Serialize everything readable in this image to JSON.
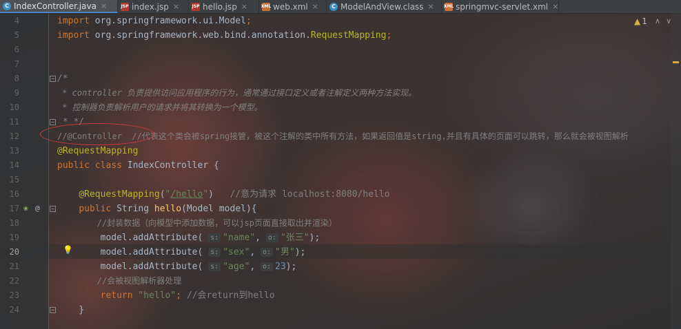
{
  "tabs": [
    {
      "label": "IndexController.java",
      "icon": "java-class-icon",
      "active": true
    },
    {
      "label": "index.jsp",
      "icon": "jsp-file-icon"
    },
    {
      "label": "hello.jsp",
      "icon": "jsp-file-icon"
    },
    {
      "label": "web.xml",
      "icon": "xml-file-icon"
    },
    {
      "label": "ModelAndView.class",
      "icon": "java-class-icon"
    },
    {
      "label": "springmvc-servlet.xml",
      "icon": "xml-file-icon"
    }
  ],
  "inspections": {
    "warning_count": "1",
    "up": "^",
    "down": "v"
  },
  "current_line": "20",
  "lines": [
    {
      "n": "4",
      "text": "import org.springframework.ui.Model;"
    },
    {
      "n": "5",
      "text": "import org.springframework.web.bind.annotation.RequestMapping;"
    },
    {
      "n": "6",
      "text": ""
    },
    {
      "n": "7",
      "text": ""
    },
    {
      "n": "8",
      "text": "/*"
    },
    {
      "n": "9",
      "text": " * controller 负责提供访问应用程序的行为，通常通过接口定义或者注解定义两种方法实现。"
    },
    {
      "n": "10",
      "text": " * 控制器负责解析用户的请求并将其转换为一个模型。"
    },
    {
      "n": "11",
      "text": " * */"
    },
    {
      "n": "12",
      "text": "//@Controller  //代表这个类会被spring接管，被这个注解的类中所有方法，如果返回值是string,并且有具体的页面可以跳转，那么就会被视图解析"
    },
    {
      "n": "13",
      "text": "@RequestMapping"
    },
    {
      "n": "14",
      "text": "public class IndexController {"
    },
    {
      "n": "15",
      "text": ""
    },
    {
      "n": "16",
      "text": "    @RequestMapping(\"/hello\")   //意为请求 localhost:8080/hello"
    },
    {
      "n": "17",
      "text": "    public String hello(Model model){"
    },
    {
      "n": "18",
      "text": "        //封装数据（向模型中添加数据，可以jsp页面直接取出并渲染）"
    },
    {
      "n": "19",
      "text": "        model.addAttribute( s: \"name\", o: \"张三\");"
    },
    {
      "n": "20",
      "text": "        model.addAttribute( s: \"sex\", o: \"男\");"
    },
    {
      "n": "21",
      "text": "        model.addAttribute( s: \"age\", o: 23);"
    },
    {
      "n": "22",
      "text": "        //会被视图解析器处理"
    },
    {
      "n": "23",
      "text": "        return \"hello\"; //会return到hello"
    },
    {
      "n": "24",
      "text": "    }"
    }
  ],
  "colors": {
    "keyword": "#cc7832",
    "annotation": "#bbb529",
    "comment": "#808080",
    "string": "#6a8759",
    "number": "#6897bb",
    "method": "#ffc66d",
    "text": "#a9b7c6",
    "annotation_circle": "#d23b3b"
  }
}
